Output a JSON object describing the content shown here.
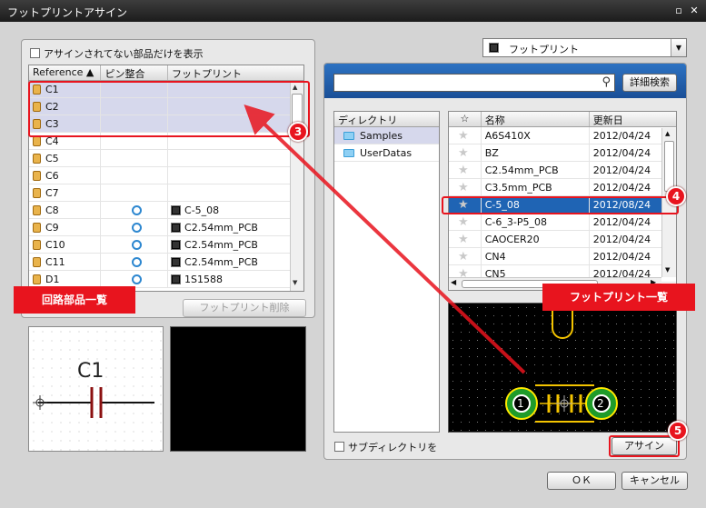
{
  "window": {
    "title": "フットプリントアサイン",
    "restore_glyph": "▫",
    "close_glyph": "✕"
  },
  "left": {
    "unassigned_only_label": "アサインされてない部品だけを表示",
    "columns": [
      "Reference ▲",
      "ピン整合",
      "フットプリント"
    ],
    "rows": [
      {
        "ref": "C1",
        "pin": false,
        "fp": ""
      },
      {
        "ref": "C2",
        "pin": false,
        "fp": ""
      },
      {
        "ref": "C3",
        "pin": false,
        "fp": ""
      },
      {
        "ref": "C4",
        "pin": false,
        "fp": ""
      },
      {
        "ref": "C5",
        "pin": false,
        "fp": ""
      },
      {
        "ref": "C6",
        "pin": false,
        "fp": ""
      },
      {
        "ref": "C7",
        "pin": false,
        "fp": ""
      },
      {
        "ref": "C8",
        "pin": true,
        "fp": "C-5_08"
      },
      {
        "ref": "C9",
        "pin": true,
        "fp": "C2.54mm_PCB"
      },
      {
        "ref": "C10",
        "pin": true,
        "fp": "C2.54mm_PCB"
      },
      {
        "ref": "C11",
        "pin": true,
        "fp": "C2.54mm_PCB"
      },
      {
        "ref": "D1",
        "pin": true,
        "fp": "1S1588"
      }
    ],
    "delete_button": "フットプリント削除",
    "schematic_label": "C1"
  },
  "right": {
    "mode_select": "フットプリント",
    "search_value": "",
    "detail_search_button": "詳細検索",
    "directory_header": "ディレクトリ",
    "directories": [
      "Samples",
      "UserDatas"
    ],
    "list_columns": [
      "☆",
      "名称",
      "更新日"
    ],
    "footprints": [
      {
        "name": "A6S410X",
        "date": "2012/04/24"
      },
      {
        "name": "BZ",
        "date": "2012/04/24"
      },
      {
        "name": "C2.54mm_PCB",
        "date": "2012/04/24"
      },
      {
        "name": "C3.5mm_PCB",
        "date": "2012/04/24"
      },
      {
        "name": "C-5_08",
        "date": "2012/08/24"
      },
      {
        "name": "C-6_3-P5_08",
        "date": "2012/04/24"
      },
      {
        "name": "CAOCER20",
        "date": "2012/04/24"
      },
      {
        "name": "CN4",
        "date": "2012/04/24"
      },
      {
        "name": "CN5",
        "date": "2012/04/24"
      }
    ],
    "subdir_label": "サブディレクトリを",
    "assign_button": "アサイン",
    "pad_labels": [
      "1",
      "2"
    ]
  },
  "footer": {
    "ok_button": "ＯＫ",
    "cancel_button": "キャンセル"
  },
  "annotations": {
    "circuit_parts_label": "回路部品一覧",
    "footprint_list_label": "フットプリント一覧",
    "badges": [
      "3",
      "4",
      "5"
    ]
  },
  "colors": {
    "annotation_red": "#e8141e",
    "selection_blue": "#1f64b4",
    "pcb_yellow": "#f4c400",
    "pad_green": "#1f9b2a"
  }
}
